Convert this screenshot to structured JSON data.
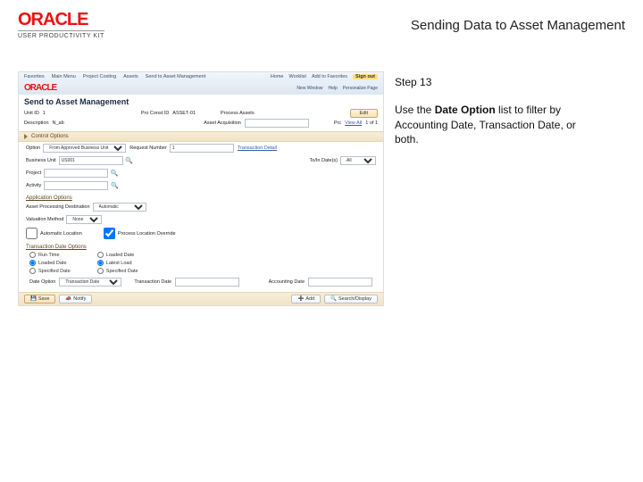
{
  "header": {
    "brand_main": "ORACLE",
    "brand_sub": "USER PRODUCTIVITY KIT",
    "page_title": "Sending Data to Asset Management"
  },
  "instructions": {
    "step_label": "Step 13",
    "line1a": "Use the ",
    "line1_bold": "Date Option",
    "line1b": " list to filter by Accounting Date, Transaction Date, or both."
  },
  "app": {
    "menubar": {
      "items": [
        "Favorites",
        "Main Menu",
        "Project Costing",
        "Assets",
        "Send to Asset Management"
      ],
      "right_items": [
        "Home",
        "Worklist",
        "Add to Favorites"
      ],
      "signout": "Sign out"
    },
    "logobar": {
      "logo": "ORACLE",
      "links": [
        "New Window",
        "Help",
        "Personalize Page"
      ]
    },
    "title": "Send to Asset Management",
    "header_rows": {
      "bu_lbl": "Unit ID",
      "bu_val": "1",
      "pc_lbl": "Pro Const ID",
      "pc_val": "ASSET-01",
      "pa_lbl": "Process Assets",
      "edit_btn": "Edit",
      "desc_lbl": "Description",
      "desc_val": "N_ab",
      "acq_lbl": "Asset Acquisition",
      "acq_val": "",
      "prs_lbl": "Prc",
      "view_all": "View All",
      "pager": "1 of 1"
    },
    "sec_control": {
      "title": "Control Options",
      "option_lbl": "Option",
      "option_val": "From Approved Business Unit",
      "reqseq_lbl": "Request Number",
      "reqseq_val": "1",
      "txndtl_lbl": "Transaction Detail",
      "bu_lbl": "Business Unit",
      "bu_val": "US001",
      "todate_lbl": "To/In Date(s)",
      "todate_val": "All",
      "project_lbl": "Project",
      "activity_lbl": "Activity"
    },
    "sec_appl": {
      "title": "Application Options",
      "dest_lbl": "Asset Processing Destination",
      "dest_val": "Automatic",
      "valmeth_lbl": "Valuation Method",
      "valmeth_val": "None",
      "aut_lbl": "Automatic Location",
      "aut_chk": false,
      "prof_lbl": "Process Location Override",
      "prof_chk": true
    },
    "sec_txn": {
      "title": "Transaction Date Options",
      "left_opts": {
        "run_time": "Run Time",
        "loaded_date": "Loaded Date",
        "specified_date": "Specified Date"
      },
      "right_opts": {
        "loaded_date": "Loaded Date",
        "latest_load": "Latest Load",
        "specified_date": "Specified Date"
      },
      "left_selected": "loaded_date",
      "right_selected": "latest_load",
      "dateopt_lbl": "Date Option",
      "dateopt_val": "Transaction Date",
      "txndate_lbl": "Transaction Date",
      "acctdate_lbl": "Accounting Date"
    },
    "footer": {
      "save": "Save",
      "notify": "Notify",
      "add": "Add",
      "search": "Search/Display"
    }
  }
}
